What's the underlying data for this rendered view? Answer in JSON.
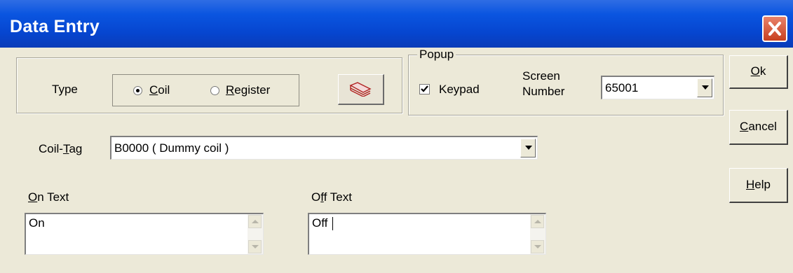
{
  "window": {
    "title": "Data Entry",
    "close_icon": "close-icon"
  },
  "type_group": {
    "label": "Type",
    "coil_prefix": "",
    "coil_hotkey": "C",
    "coil_rest": "oil",
    "register_hotkey": "R",
    "register_rest": "egister",
    "selected": "Coil"
  },
  "tag_browser_icon": "tag-browse-icon",
  "popup": {
    "legend": "Popup",
    "keypad_hotkey": "",
    "keypad_label": "Keypad",
    "keypad_checked": true,
    "screen_number_label_line1": "Screen",
    "screen_number_label_line2": "Number",
    "screen_number_value": "65001"
  },
  "coil_tag": {
    "label_pre": "Coil-",
    "label_hotkey": "T",
    "label_post": "ag",
    "value": "B0000 ( Dummy coil )"
  },
  "on_text": {
    "label_hotkey": "O",
    "label_rest": "n Text",
    "value": "On"
  },
  "off_text": {
    "label_pre": "O",
    "label_hotkey": "f",
    "label_post": "f Text",
    "value": "Off"
  },
  "buttons": {
    "ok_hotkey": "O",
    "ok_rest": "k",
    "cancel_hotkey": "C",
    "cancel_rest": "ancel",
    "help_hotkey": "H",
    "help_rest": "elp"
  },
  "colors": {
    "titlebar": "#0a55e0",
    "dialog_bg": "#ece9d8",
    "close_button": "#d5552f"
  }
}
